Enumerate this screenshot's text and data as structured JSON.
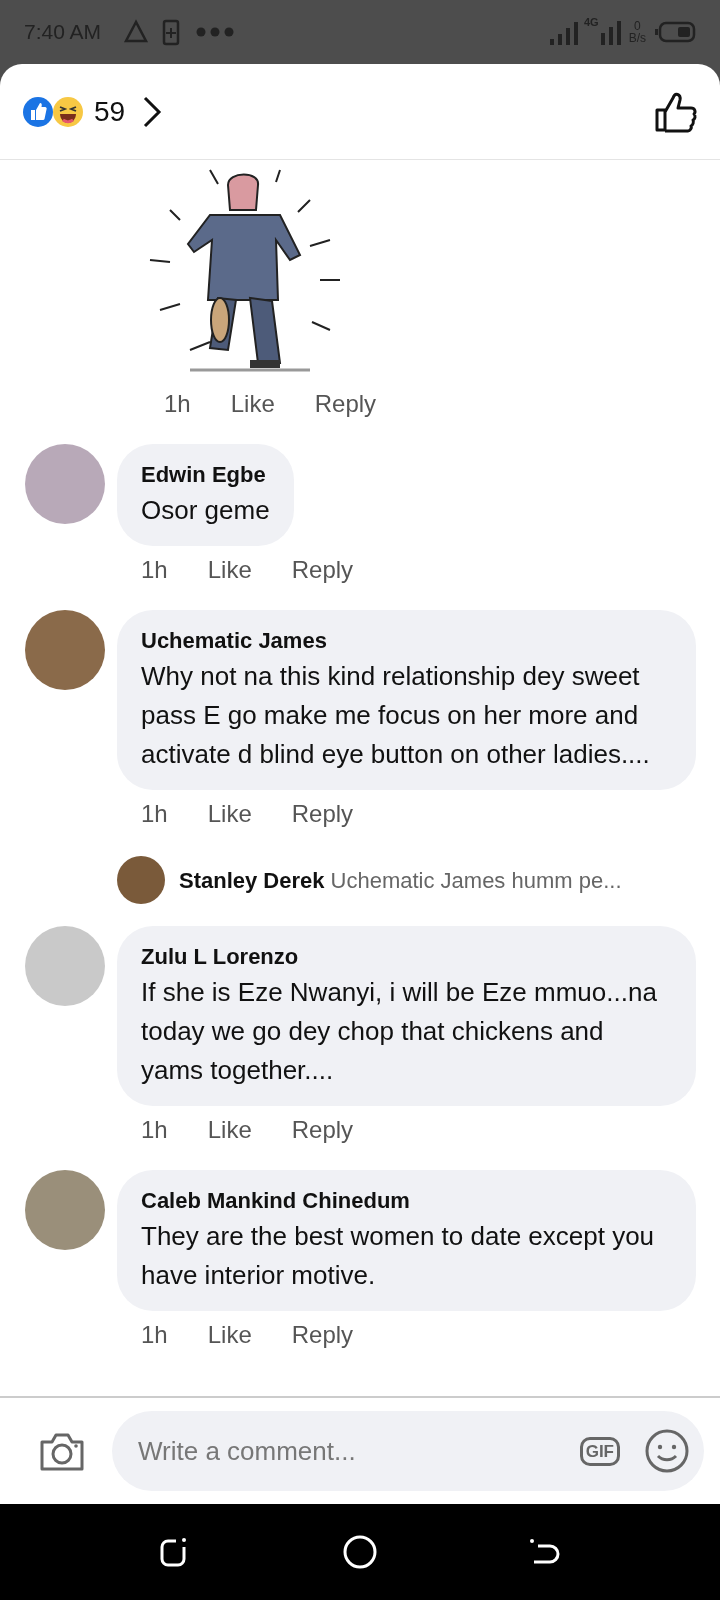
{
  "status_bar": {
    "time": "7:40 AM",
    "network": "4G",
    "speed": "0",
    "speed_unit": "B/s"
  },
  "reactions": {
    "count": "59"
  },
  "comments": [
    {
      "kind": "sticker",
      "time": "1h",
      "like": "Like",
      "reply": "Reply"
    },
    {
      "kind": "text",
      "author": "Edwin Egbe",
      "text": "Osor geme",
      "time": "1h",
      "like": "Like",
      "reply": "Reply"
    },
    {
      "kind": "text",
      "author": "Uchematic James",
      "text": "Why not na this kind relationship dey sweet pass E go make me focus on her more and activate d blind eye button on other ladies....",
      "time": "1h",
      "like": "Like",
      "reply": "Reply",
      "replies": [
        {
          "author": "Stanley Derek",
          "text": "Uchematic James humm pe..."
        }
      ]
    },
    {
      "kind": "text",
      "author": "Zulu L Lorenzo",
      "text": "If she is Eze Nwanyi, i will be Eze mmuo...na today we go dey chop that chickens and yams together....",
      "time": "1h",
      "like": "Like",
      "reply": "Reply"
    },
    {
      "kind": "text",
      "author": "Caleb Mankind Chinedum",
      "text": "They are the best women to date except you have interior motive.",
      "time": "1h",
      "like": "Like",
      "reply": "Reply"
    }
  ],
  "composer": {
    "placeholder": "Write a comment...",
    "gif_label": "GIF"
  }
}
